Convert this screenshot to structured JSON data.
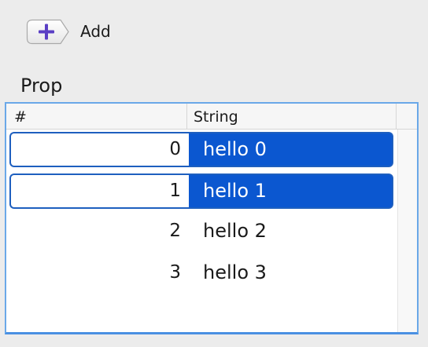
{
  "toolbar": {
    "add_label": "Add",
    "add_icon": "plus-icon",
    "accent": "#5a3fc4"
  },
  "section": {
    "label": "Prop"
  },
  "table": {
    "columns": [
      "#",
      "String"
    ],
    "rows": [
      {
        "index": "0",
        "value": "hello 0",
        "selected": true
      },
      {
        "index": "1",
        "value": "hello 1",
        "selected": true
      },
      {
        "index": "2",
        "value": "hello 2",
        "selected": false
      },
      {
        "index": "3",
        "value": "hello 3",
        "selected": false
      }
    ],
    "selection_color": "#0b57d0",
    "focus_border_color": "#6aa8e8"
  }
}
